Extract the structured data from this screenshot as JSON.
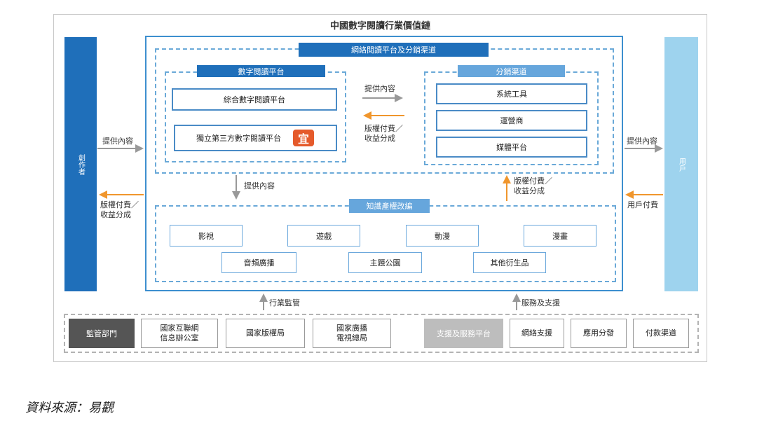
{
  "title": "中國數字閱讀行業價值鏈",
  "creator": "創作者",
  "user": "用戶",
  "network": {
    "header": "網絡閱讀平台及分銷渠道",
    "platform": {
      "header": "數字閱讀平台",
      "items": [
        "綜合數字閱讀平台",
        "獨立第三方數字閱讀平台"
      ],
      "logo_char": "宜"
    },
    "distribution": {
      "header": "分銷渠道",
      "items": [
        "系統工具",
        "運營商",
        "媒體平台"
      ]
    }
  },
  "ip": {
    "header": "知識產權改編",
    "row1": [
      "影視",
      "遊戲",
      "動漫",
      "漫畫"
    ],
    "row2": [
      "音頻廣播",
      "主題公園",
      "其他衍生品"
    ]
  },
  "labels": {
    "provide_content": "提供內容",
    "royalty_line1": "版權付費／",
    "royalty_line2": "收益分成",
    "user_payment": "用戶付費",
    "industry_supervision": "行業監管",
    "service_support": "服務及支援"
  },
  "supervision": {
    "header": "監管部門",
    "items": [
      [
        "國家互聯網",
        "信息辦公室"
      ],
      [
        "國家版權局"
      ],
      [
        "國家廣播",
        "電視總局"
      ]
    ]
  },
  "support": {
    "header": "支援及服務平台",
    "items": [
      "網絡支援",
      "應用分發",
      "付款渠道"
    ]
  },
  "source": "資料來源：易觀",
  "colors": {
    "gray_arrow": "#999999",
    "orange_arrow": "#f0962d",
    "creator": "#1f6fba",
    "user": "#9ed3ee",
    "header_blue": "#1f6fba",
    "header_light": "#66a6dc"
  }
}
